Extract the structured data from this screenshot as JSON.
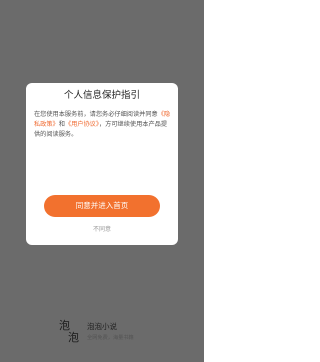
{
  "dialog": {
    "title": "个人信息保护指引",
    "body_text_1": "在您使用本服务前，请您务必仔细阅读并同意",
    "privacy_policy_link": "《隐私政策》",
    "body_text_2": "和",
    "user_agreement_link": "《用户协议》",
    "body_text_3": "，方可继续使用本产品提供的阅读服务。",
    "agree_button_label": "同意并进入首页",
    "disagree_label": "不同意"
  },
  "brand": {
    "logo_char_1": "泡",
    "logo_char_2": "泡",
    "name": "泡泡小说",
    "slogan": "全网免费，海量书籍"
  },
  "colors": {
    "overlay": "#6b6b6b",
    "accent": "#f2712e",
    "link": "#f06a30"
  }
}
